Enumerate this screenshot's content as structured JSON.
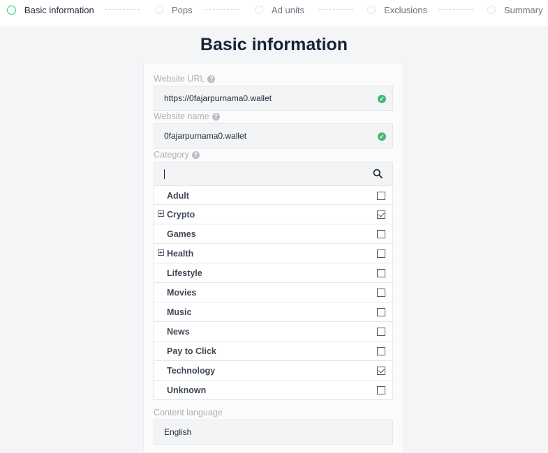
{
  "steps": [
    {
      "label": "Basic information",
      "active": true
    },
    {
      "label": "Pops",
      "active": false
    },
    {
      "label": "Ad units",
      "active": false
    },
    {
      "label": "Exclusions",
      "active": false
    },
    {
      "label": "Summary",
      "active": false
    }
  ],
  "page_title": "Basic information",
  "website_url": {
    "label": "Website URL",
    "value": "https://0fajarpurnama0.wallet",
    "valid": true
  },
  "website_name": {
    "label": "Website name",
    "value": "0fajarpurnama0.wallet",
    "valid": true
  },
  "category": {
    "label": "Category",
    "search_value": "",
    "items": [
      {
        "name": "Adult",
        "expandable": false,
        "checked": false
      },
      {
        "name": "Crypto",
        "expandable": true,
        "checked": true
      },
      {
        "name": "Games",
        "expandable": false,
        "checked": false
      },
      {
        "name": "Health",
        "expandable": true,
        "checked": false
      },
      {
        "name": "Lifestyle",
        "expandable": false,
        "checked": false
      },
      {
        "name": "Movies",
        "expandable": false,
        "checked": false
      },
      {
        "name": "Music",
        "expandable": false,
        "checked": false
      },
      {
        "name": "News",
        "expandable": false,
        "checked": false
      },
      {
        "name": "Pay to Click",
        "expandable": false,
        "checked": false
      },
      {
        "name": "Technology",
        "expandable": false,
        "checked": true
      },
      {
        "name": "Unknown",
        "expandable": false,
        "checked": false
      }
    ]
  },
  "content_language": {
    "label": "Content language",
    "value": "English"
  },
  "icons": {
    "help": "question-mark-icon",
    "valid": "checkmark-circle-icon",
    "search": "search-icon"
  },
  "colors": {
    "accent_green": "#2ecc71",
    "valid_green": "#44b97a",
    "title": "#16243a"
  }
}
